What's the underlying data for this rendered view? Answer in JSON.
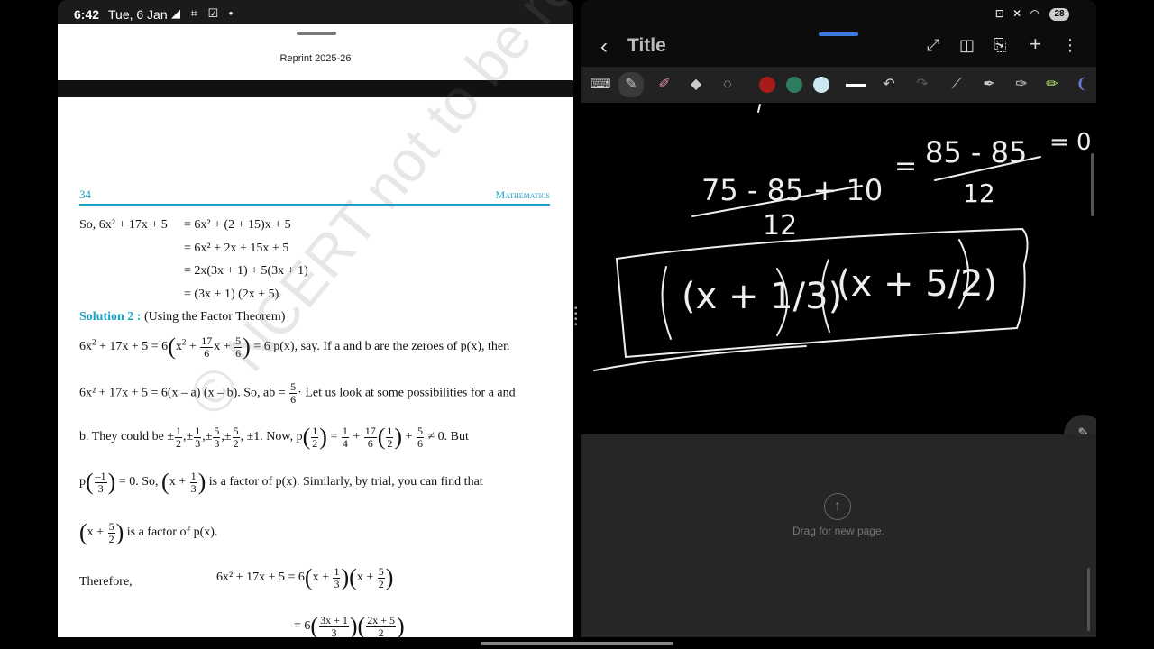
{
  "left": {
    "status": {
      "time": "6:42",
      "date": "Tue, 6 Jan",
      "icons": "◢ ⌗ ☑ •"
    },
    "page_header": "Reprint 2025-26",
    "page_number": "34",
    "subject": "Mathematics",
    "lines": {
      "l1_lhs": "So, 6x² + 17x + 5",
      "l1_rhs": "= 6x² + (2 + 15)x + 5",
      "l2": "= 6x² + 2x + 15x + 5",
      "l3": "= 2x(3x + 1) + 5(3x + 1)",
      "l4": "= (3x + 1) (2x + 5)",
      "solution_label": "Solution 2 :",
      "solution_text": "(Using the Factor Theorem)",
      "l6_tail": "= 6 p(x), say. If a and b are the zeroes of p(x), then",
      "l7_a": "6x² + 17x + 5 = 6(x – a) (x – b). So, ab =",
      "l7_b": "Let us look at some possibilities for a and",
      "l8_a": "b. They could be",
      "l8_b": "Now,",
      "l8_c": "≠ 0. But",
      "l9_a": "= 0. So,",
      "l9_b": "is a factor of p(x). Similarly, by trial, you can find that",
      "l10": "is a factor of p(x).",
      "therefore": "Therefore,",
      "l11": "6x² + 17x + 5 = 6"
    },
    "watermark": "© NCERT not to be republished"
  },
  "right": {
    "title": "Title",
    "canvas_hint": "Drag for new page.",
    "battery": "28",
    "status_icons": "⊡ ✕ ◠"
  },
  "handwriting": {
    "fraction1_num": "75 - 85 + 10",
    "fraction1_den": "12",
    "fraction2_num": "85 - 85",
    "fraction2_den": "12",
    "equals": "=",
    "result": "= 0",
    "factor1": "(x + 1/3)",
    "factor2": "(x + 5/2)"
  },
  "colors": {
    "swatch_red": "#a81b1b",
    "swatch_green": "#2e7d5e",
    "swatch_lightblue": "#cde7f0",
    "accent_blue": "#3d7be0",
    "ncert_cyan": "#1aa3c8"
  }
}
